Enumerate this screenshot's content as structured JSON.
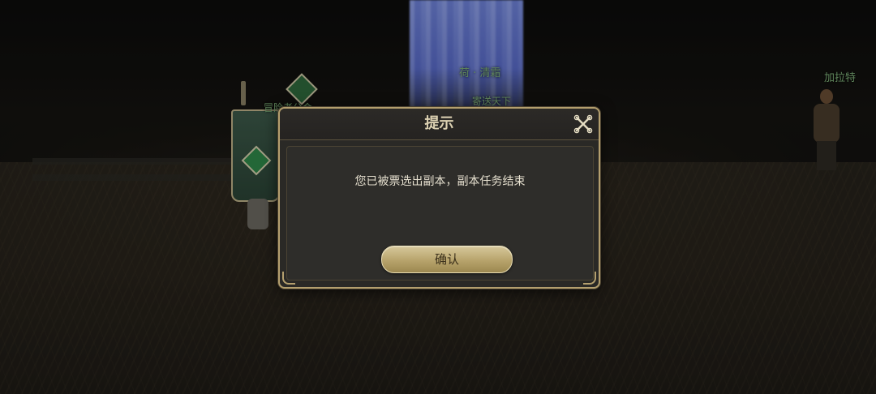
{
  "scene": {
    "npc_labels": {
      "top": "荷 · 清霜",
      "under_top": "寄送天下",
      "left": "冒险者公会",
      "right": "加拉特"
    },
    "accent_colors": {
      "npc_label_green": "#7fb27a",
      "frame_gold": "#b49f6e"
    }
  },
  "dialog": {
    "title": "提示",
    "close_icon": "close-icon",
    "message": "您已被票选出副本，副本任务结束",
    "confirm_label": "确认"
  }
}
